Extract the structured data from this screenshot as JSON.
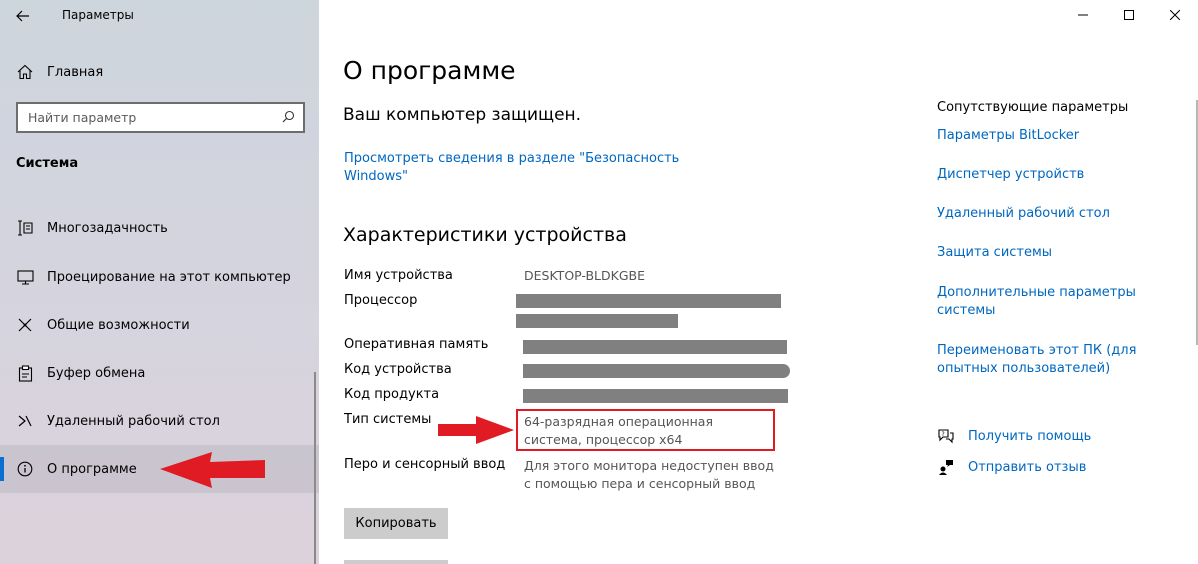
{
  "window": {
    "title": "Параметры"
  },
  "sidebar": {
    "home_label": "Главная",
    "search_placeholder": "Найти параметр",
    "section_header": "Система",
    "items": [
      {
        "label": "Многозадачность",
        "icon": "multitasking-icon"
      },
      {
        "label": "Проецирование на этот компьютер",
        "icon": "projecting-icon"
      },
      {
        "label": "Общие возможности",
        "icon": "shared-experiences-icon"
      },
      {
        "label": "Буфер обмена",
        "icon": "clipboard-icon"
      },
      {
        "label": "Удаленный рабочий стол",
        "icon": "remote-desktop-icon"
      },
      {
        "label": "О программе",
        "icon": "info-icon",
        "active": true
      }
    ]
  },
  "main": {
    "title": "О программе",
    "protection_status": "Ваш компьютер защищен.",
    "security_link": "Просмотреть сведения в разделе \"Безопасность Windows\"",
    "specs_title": "Характеристики устройства",
    "specs": {
      "device_name_label": "Имя устройства",
      "device_name_value": "DESKTOP-BLDKGBE",
      "processor_label": "Процессор",
      "ram_label": "Оперативная память",
      "device_id_label": "Код устройства",
      "product_id_label": "Код продукта",
      "system_type_label": "Тип системы",
      "system_type_value": "64-разрядная операционная система, процессор x64",
      "pen_touch_label": "Перо и сенсорный ввод",
      "pen_touch_value": "Для этого монитора недоступен ввод с помощью пера и сенсорный ввод"
    },
    "copy_button": "Копировать"
  },
  "related": {
    "title": "Сопутствующие параметры",
    "links": [
      "Параметры BitLocker",
      "Диспетчер устройств",
      "Удаленный рабочий стол",
      "Защита системы",
      "Дополнительные параметры системы",
      "Переименовать этот ПК (для опытных пользователей)"
    ],
    "help": "Получить помощь",
    "feedback": "Отправить отзыв"
  },
  "colors": {
    "accent": "#0a6fd0",
    "link": "#0067c0",
    "annotation": "#e01b24"
  }
}
